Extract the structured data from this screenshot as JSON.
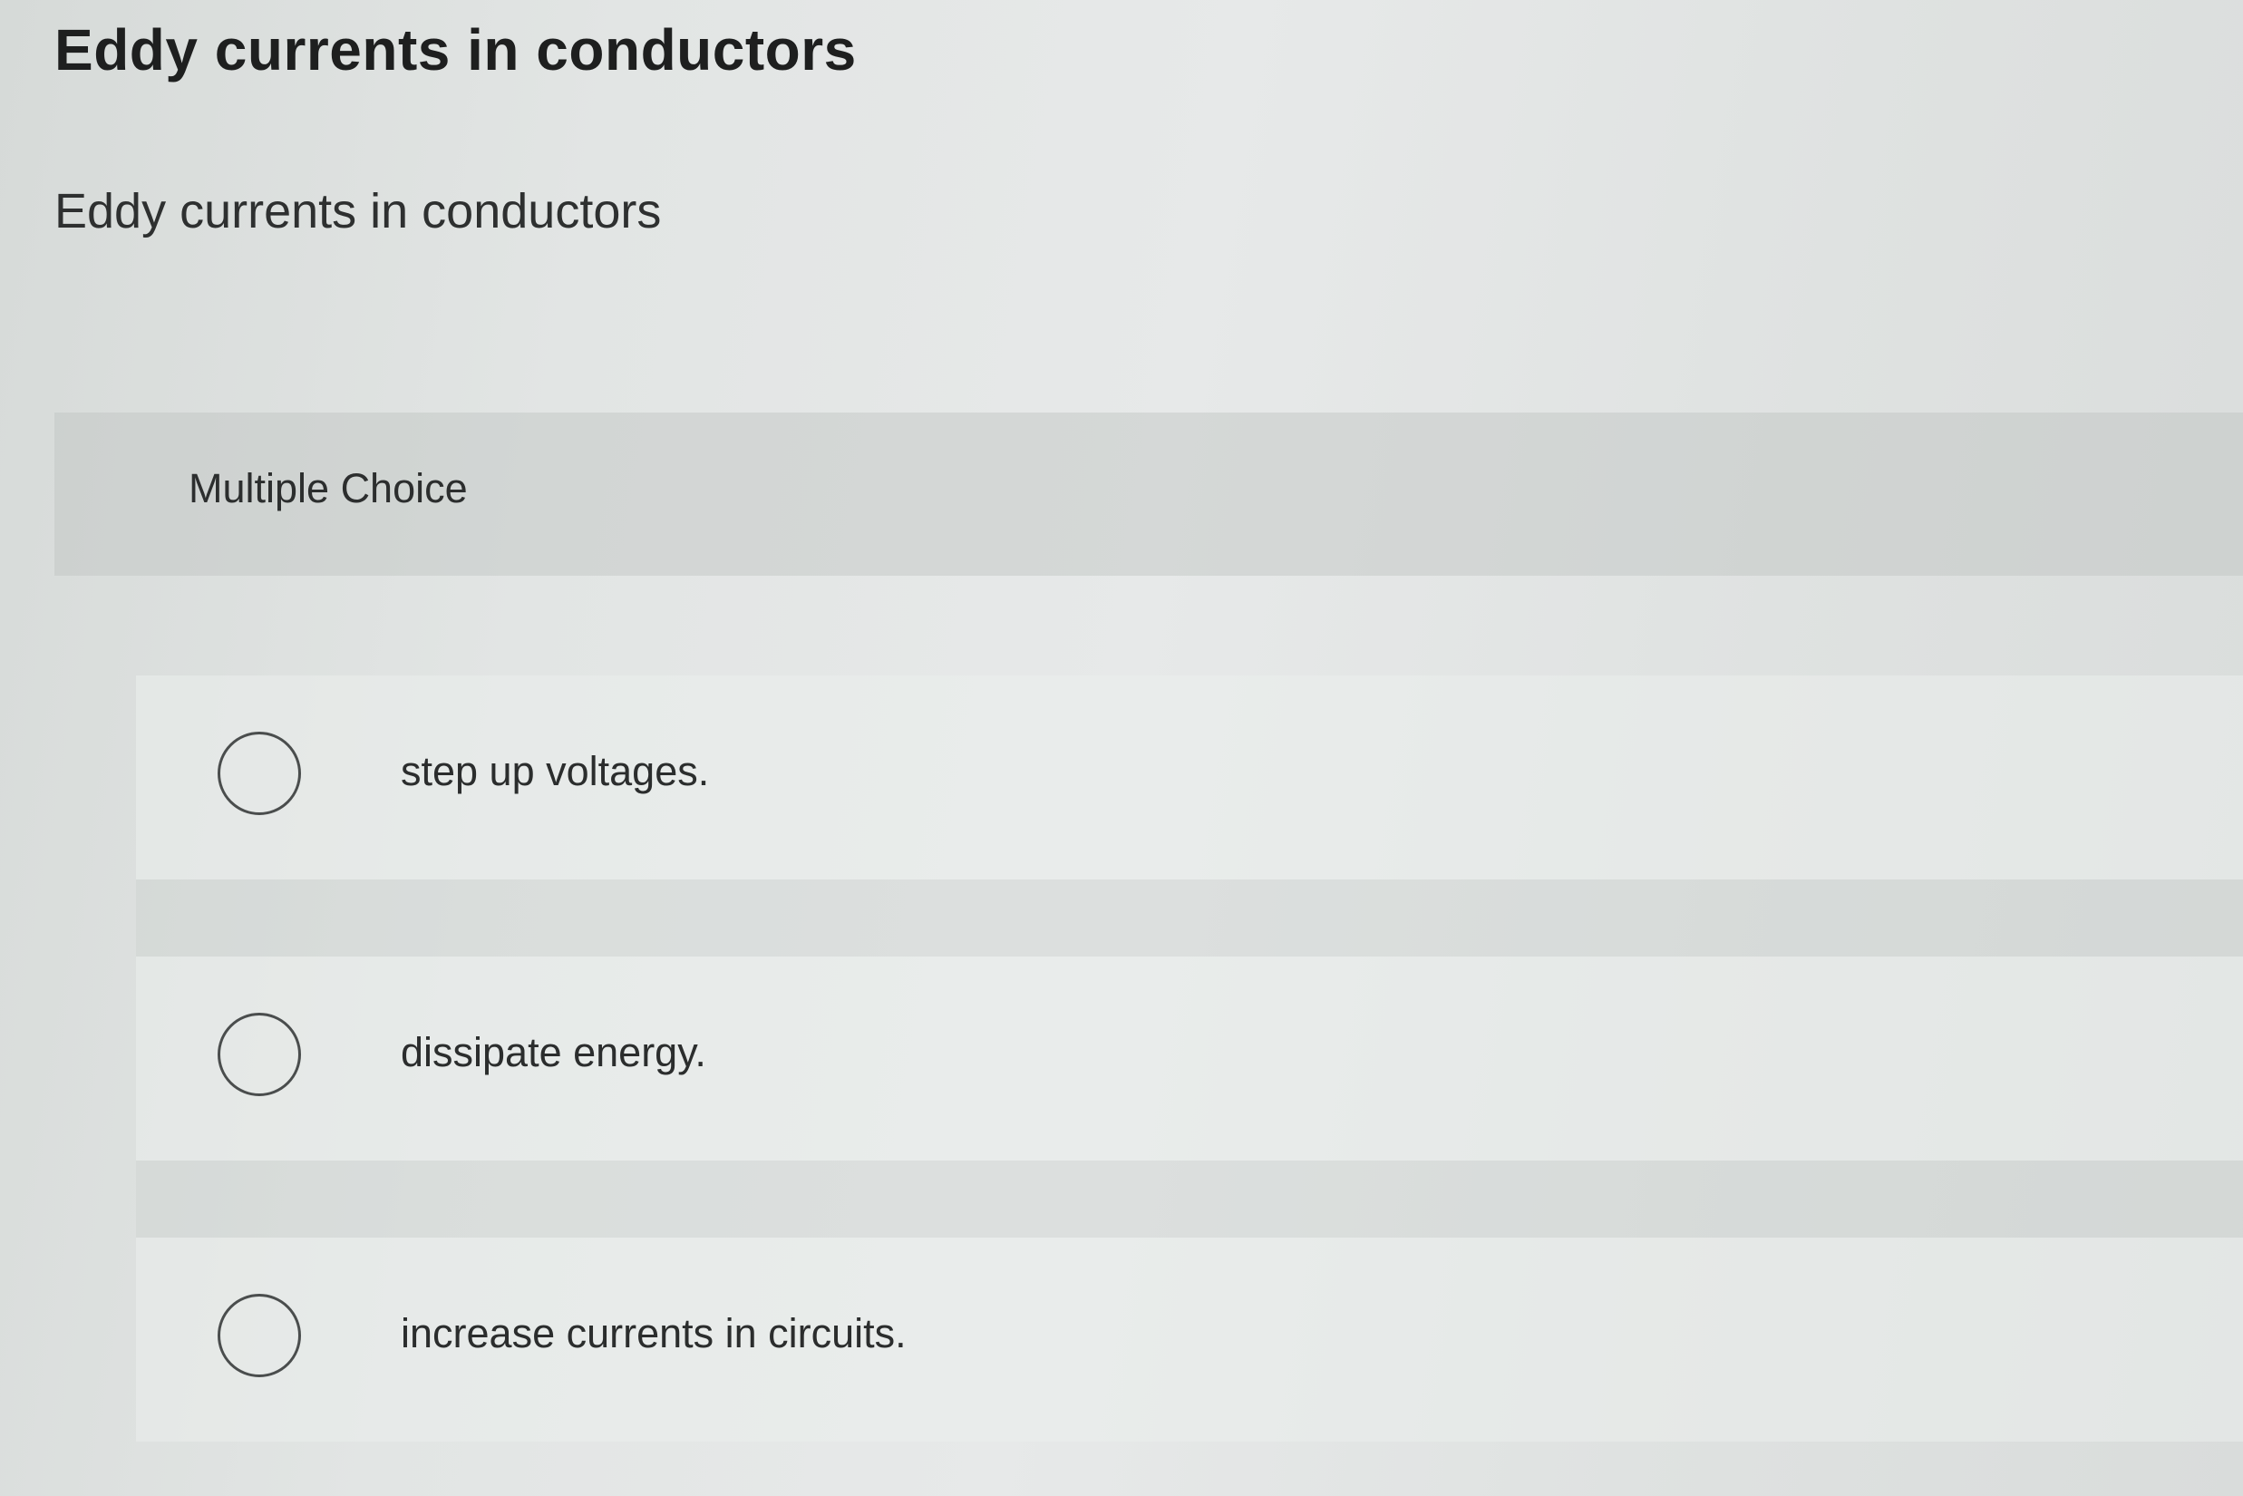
{
  "page": {
    "title": "Eddy currents in conductors"
  },
  "question": {
    "text": "Eddy currents in conductors",
    "type_label": "Multiple Choice",
    "options": [
      {
        "label": "step up voltages.",
        "selected": false
      },
      {
        "label": "dissipate energy.",
        "selected": false
      },
      {
        "label": "increase currents in circuits.",
        "selected": false
      }
    ]
  }
}
